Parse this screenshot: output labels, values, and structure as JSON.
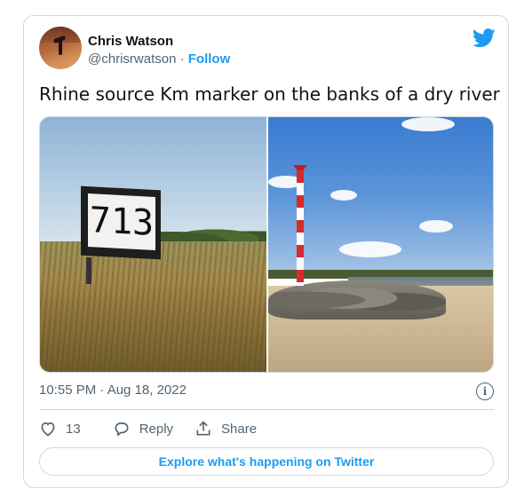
{
  "author": {
    "name": "Chris Watson",
    "handle": "@chrisrwatson",
    "separator": "·",
    "follow_label": "Follow"
  },
  "tweet": {
    "text": "Rhine source Km marker on the banks of a dry river",
    "timestamp": "10:55 PM · Aug 18, 2022",
    "sign_number": "713"
  },
  "actions": {
    "like_count": "13",
    "reply_label": "Reply",
    "share_label": "Share"
  },
  "explore_label": "Explore what's happening on Twitter",
  "icons": {
    "brand": "twitter-bird-icon",
    "info": "info-icon",
    "like": "heart-icon",
    "reply": "speech-bubble-icon",
    "share": "share-upload-icon"
  },
  "colors": {
    "accent": "#1d9bf0",
    "text": "#0f1419",
    "secondary": "#536471",
    "border": "#cfd9de"
  }
}
